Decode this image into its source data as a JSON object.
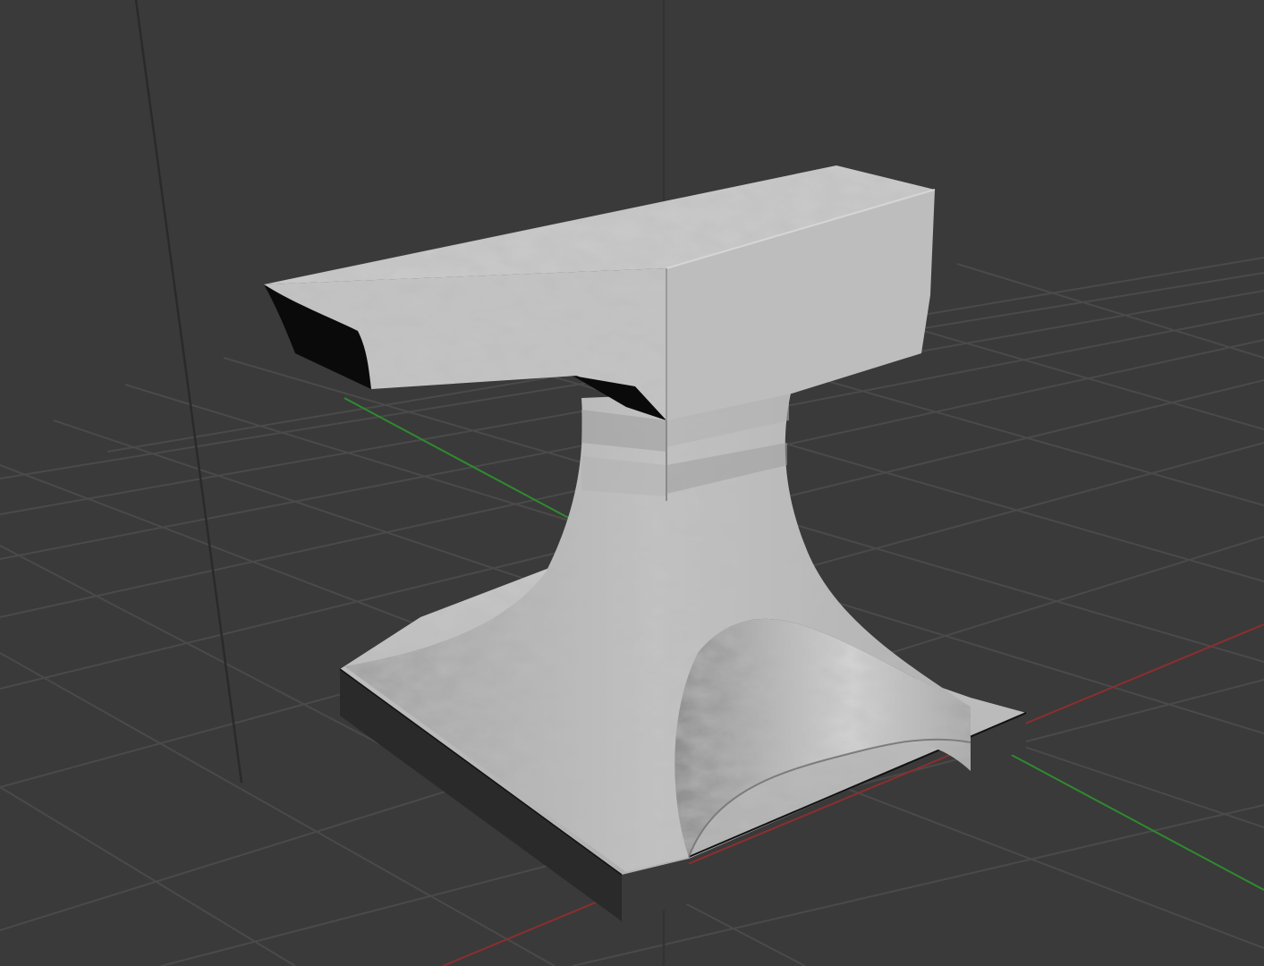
{
  "viewport": {
    "background_color": "#3a3a3a",
    "grid_line_color": "#4a4a4a",
    "x_axis_color": "#8c2e2e",
    "y_axis_color": "#2f8a2f",
    "z_axis_color": "#2a2a2a"
  },
  "object": {
    "shape": "anvil",
    "material": "white-marble-texture",
    "base_color": "#b4b4b4",
    "highlight_color": "#cfcfcf",
    "shadow_color": "#7a7a7a",
    "dark_color": "#101010"
  }
}
